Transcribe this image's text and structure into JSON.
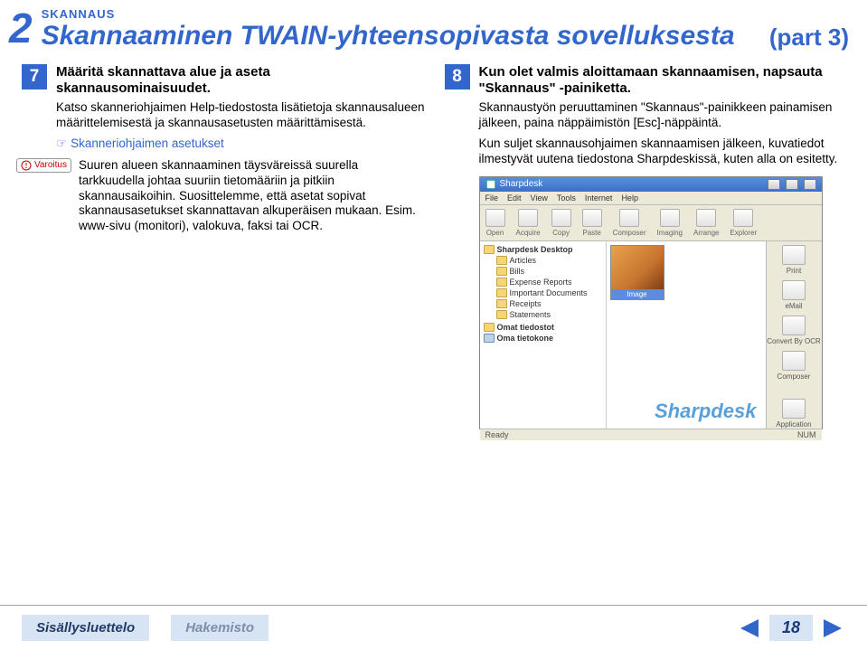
{
  "chapter_number": "2",
  "sub_header": "SKANNAUS",
  "title": "Skannaaminen TWAIN-yhteensopivasta sovelluksesta",
  "part_label": "(part 3)",
  "step7": {
    "num": "7",
    "title": "Määritä skannattava alue ja aseta skannausominaisuudet.",
    "text": "Katso skanneriohjaimen Help-tiedostosta lisätietoja skannausalueen määrittelemisestä ja skannausasetusten määrittämisestä.",
    "link": "Skanneriohjaimen asetukset",
    "caution_label": "Varoitus",
    "caution_text": "Suuren alueen skannaaminen täysväreissä suurella tarkkuudella johtaa suuriin tietomääriin ja pitkiin skannausaikoihin. Suosittelemme, että asetat sopivat skannausasetukset skannattavan alkuperäisen mukaan. Esim. www-sivu (monitori), valokuva, faksi tai OCR."
  },
  "step8": {
    "num": "8",
    "title": "Kun olet valmis aloittamaan skannaamisen, napsauta \"Skannaus\" -painiketta.",
    "text1": "Skannaustyön peruuttaminen \"Skannaus\"-painikkeen painamisen jälkeen, paina näppäimistön [Esc]-näppäintä.",
    "text2": "Kun suljet skannausohjaimen skannaamisen jälkeen, kuvatiedot ilmestyvät uutena tiedostona Sharpdeskissä, kuten alla on esitetty."
  },
  "screenshot": {
    "title": "Sharpdesk",
    "menus": [
      "File",
      "Edit",
      "View",
      "Tools",
      "Internet",
      "Help"
    ],
    "toolbar": [
      "Open",
      "Acquire",
      "Copy",
      "Paste",
      "Composer",
      "Imaging",
      "Arrange",
      "Explorer"
    ],
    "tree_root": "Sharpdesk Desktop",
    "tree_items": [
      "Articles",
      "Bills",
      "Expense Reports",
      "Important Documents",
      "Receipts",
      "Statements"
    ],
    "tree_extra1": "Omat tiedostot",
    "tree_extra2": "Oma tietokone",
    "thumb_label": "Image",
    "brand": "Sharpdesk",
    "rightbar": [
      "Print",
      "eMail",
      "Convert By OCR",
      "Composer",
      "Application"
    ],
    "status_left": "Ready",
    "status_right": "NUM"
  },
  "footer": {
    "toc": "Sisällysluettelo",
    "index": "Hakemisto",
    "page": "18"
  }
}
